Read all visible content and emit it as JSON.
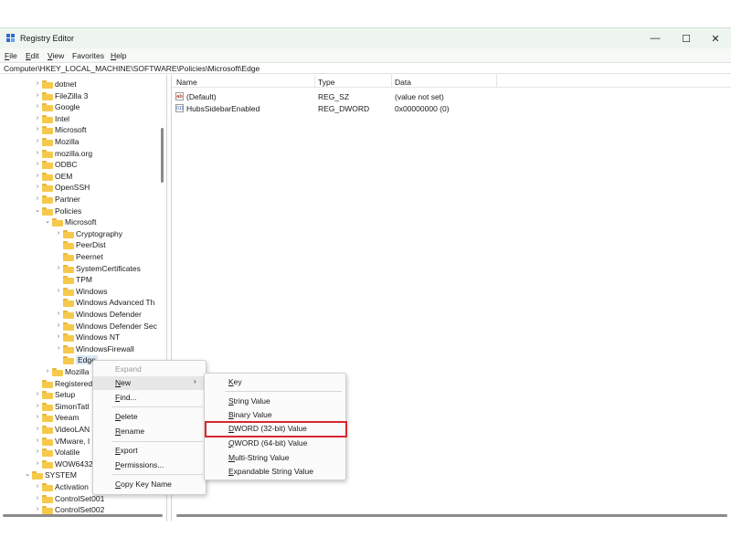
{
  "window": {
    "title": "Registry Editor",
    "controls": {
      "minimize": "—",
      "maximize": "☐",
      "close": "✕"
    }
  },
  "menu": [
    {
      "label": "File",
      "accel": "F",
      "rest": "ile"
    },
    {
      "label": "Edit",
      "accel": "E",
      "rest": "dit"
    },
    {
      "label": "View",
      "accel": "V",
      "rest": "iew"
    },
    {
      "label": "Favorites",
      "accel": "F",
      "rest": "avorites",
      "pre": "Fa"
    },
    {
      "label": "Help",
      "accel": "H",
      "rest": "elp"
    }
  ],
  "address": "Computer\\HKEY_LOCAL_MACHINE\\SOFTWARE\\Policies\\Microsoft\\Edge",
  "tree": [
    {
      "label": "dotnet",
      "depth": 2,
      "chev": "›"
    },
    {
      "label": "FileZilla 3",
      "depth": 2,
      "chev": "›"
    },
    {
      "label": "Google",
      "depth": 2,
      "chev": "›"
    },
    {
      "label": "Intel",
      "depth": 2,
      "chev": "›"
    },
    {
      "label": "Microsoft",
      "depth": 2,
      "chev": "›"
    },
    {
      "label": "Mozilla",
      "depth": 2,
      "chev": "›"
    },
    {
      "label": "mozilla.org",
      "depth": 2,
      "chev": "›"
    },
    {
      "label": "ODBC",
      "depth": 2,
      "chev": "›"
    },
    {
      "label": "OEM",
      "depth": 2,
      "chev": "›"
    },
    {
      "label": "OpenSSH",
      "depth": 2,
      "chev": "›"
    },
    {
      "label": "Partner",
      "depth": 2,
      "chev": "›"
    },
    {
      "label": "Policies",
      "depth": 2,
      "chev": "⌄"
    },
    {
      "label": "Microsoft",
      "depth": 3,
      "chev": "⌄"
    },
    {
      "label": "Cryptography",
      "depth": 4,
      "chev": "›"
    },
    {
      "label": "PeerDist",
      "depth": 4,
      "chev": ""
    },
    {
      "label": "Peernet",
      "depth": 4,
      "chev": ""
    },
    {
      "label": "SystemCertificates",
      "depth": 4,
      "chev": "›"
    },
    {
      "label": "TPM",
      "depth": 4,
      "chev": ""
    },
    {
      "label": "Windows",
      "depth": 4,
      "chev": "›"
    },
    {
      "label": "Windows Advanced Th",
      "depth": 4,
      "chev": ""
    },
    {
      "label": "Windows Defender",
      "depth": 4,
      "chev": "›"
    },
    {
      "label": "Windows Defender Sec",
      "depth": 4,
      "chev": "›"
    },
    {
      "label": "Windows NT",
      "depth": 4,
      "chev": "›"
    },
    {
      "label": "WindowsFirewall",
      "depth": 4,
      "chev": "›"
    },
    {
      "label": "Edge",
      "depth": 4,
      "chev": "",
      "selected": true
    },
    {
      "label": "Mozilla",
      "depth": 3,
      "chev": "›"
    },
    {
      "label": "Registered",
      "depth": 2,
      "chev": ""
    },
    {
      "label": "Setup",
      "depth": 2,
      "chev": "›"
    },
    {
      "label": "SimonTatl",
      "depth": 2,
      "chev": "›"
    },
    {
      "label": "Veeam",
      "depth": 2,
      "chev": "›"
    },
    {
      "label": "VideoLAN",
      "depth": 2,
      "chev": "›"
    },
    {
      "label": "VMware, I",
      "depth": 2,
      "chev": "›"
    },
    {
      "label": "Volatile",
      "depth": 2,
      "chev": "›"
    },
    {
      "label": "WOW6432",
      "depth": 2,
      "chev": "›"
    },
    {
      "label": "SYSTEM",
      "depth": 1,
      "chev": "⌄"
    },
    {
      "label": "Activation",
      "depth": 2,
      "chev": "›"
    },
    {
      "label": "ControlSet001",
      "depth": 2,
      "chev": "›"
    },
    {
      "label": "ControlSet002",
      "depth": 2,
      "chev": "›"
    }
  ],
  "list": {
    "headers": [
      "Name",
      "Type",
      "Data"
    ],
    "rows": [
      {
        "icon": "ab",
        "name": "(Default)",
        "type": "REG_SZ",
        "data": "(value not set)"
      },
      {
        "icon": "011",
        "name": "HubsSidebarEnabled",
        "type": "REG_DWORD",
        "data": "0x00000000 (0)"
      }
    ]
  },
  "context_menu": {
    "items": [
      {
        "label": "Expand",
        "accel": "",
        "disabled": true
      },
      {
        "label": "New",
        "accel": "N",
        "rest": "ew",
        "submenu": true
      },
      {
        "label": "Find...",
        "accel": "F",
        "rest": "ind..."
      },
      {
        "label": "Delete",
        "accel": "D",
        "rest": "elete"
      },
      {
        "label": "Rename",
        "accel": "R",
        "rest": "ename"
      },
      {
        "label": "Export",
        "accel": "E",
        "rest": "xport"
      },
      {
        "label": "Permissions...",
        "accel": "P",
        "rest": "ermissions..."
      },
      {
        "label": "Copy Key Name",
        "accel": "C",
        "rest": "opy Key Name"
      }
    ]
  },
  "submenu": {
    "items": [
      {
        "label": "Key",
        "accel": "K",
        "rest": "ey"
      },
      {
        "label": "String Value",
        "accel": "S",
        "rest": "tring Value"
      },
      {
        "label": "Binary Value",
        "accel": "B",
        "rest": "inary Value"
      },
      {
        "label": "DWORD (32-bit) Value",
        "accel": "D",
        "rest": "WORD (32-bit) Value",
        "highlighted": true
      },
      {
        "label": "QWORD (64-bit) Value",
        "accel": "Q",
        "rest": "WORD (64-bit) Value"
      },
      {
        "label": "Multi-String Value",
        "accel": "M",
        "rest": "ulti-String Value"
      },
      {
        "label": "Expandable String Value",
        "accel": "E",
        "rest": "xpandable String Value"
      }
    ]
  },
  "colors": {
    "folder": "#f6c94c",
    "highlight": "#d9262c",
    "selected": "#dbe8f7"
  }
}
